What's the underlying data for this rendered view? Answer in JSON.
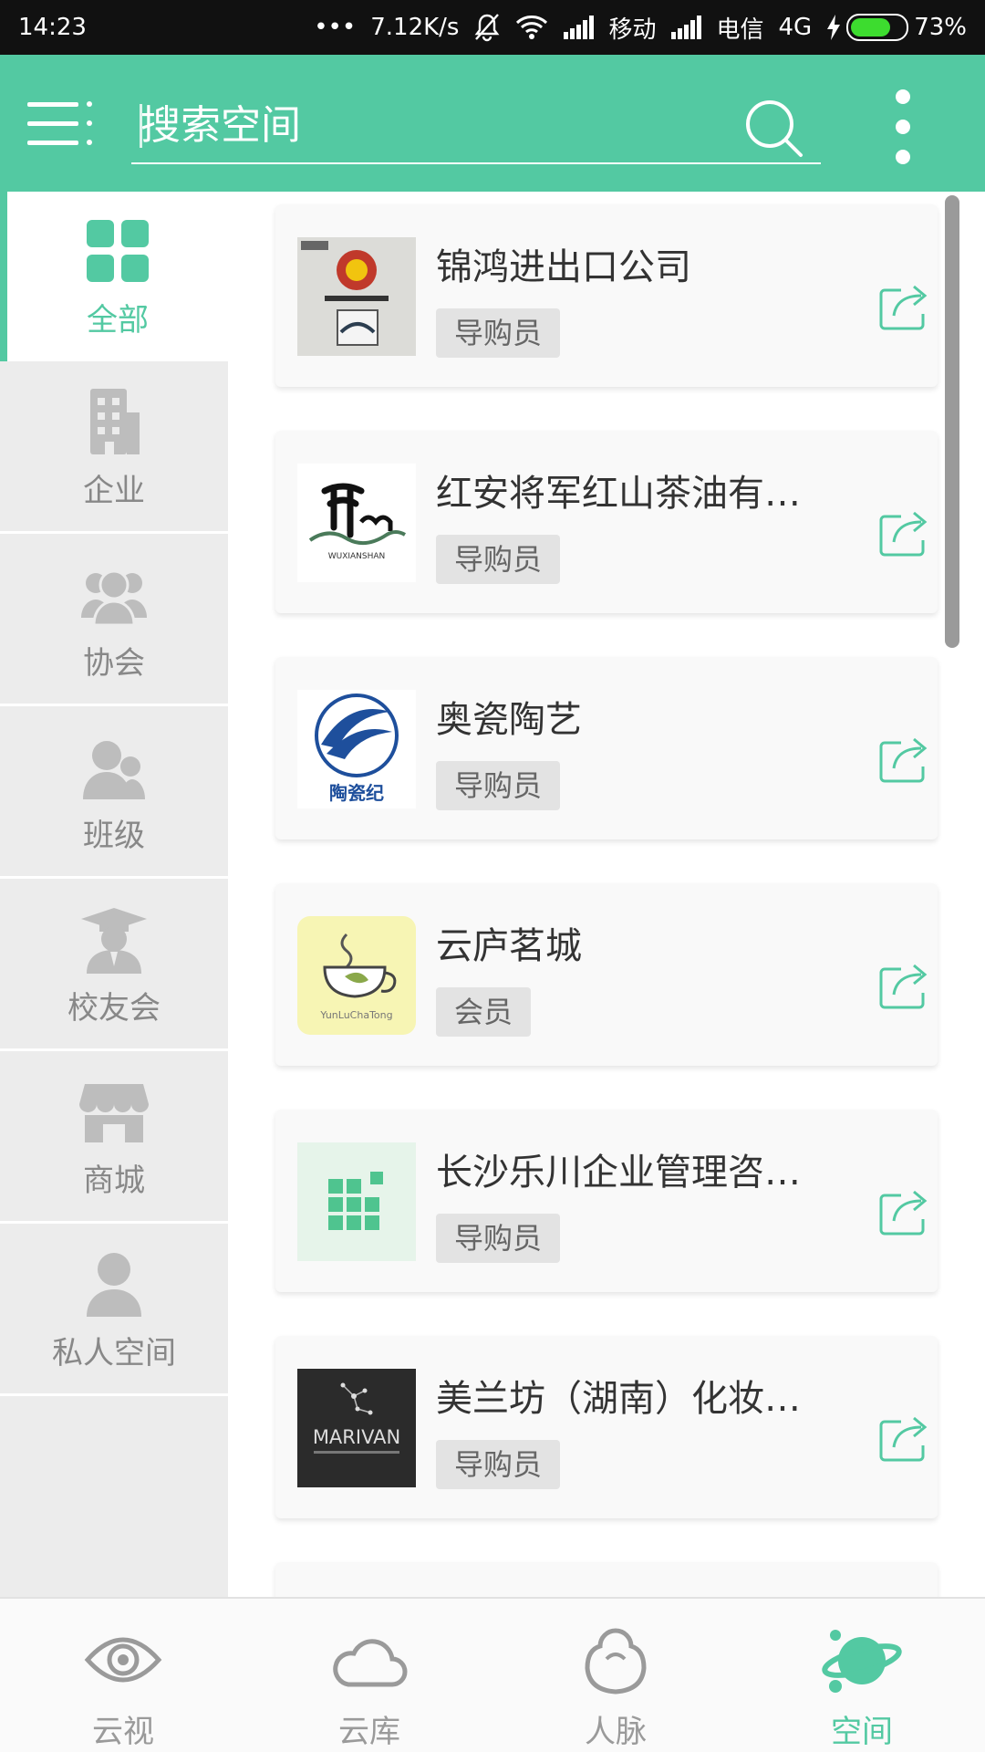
{
  "status_bar": {
    "time": "14:23",
    "dots": "•••",
    "network_speed": "7.12K/s",
    "carrier1": "移动",
    "carrier2": "电信",
    "network_type": "4G",
    "battery": "73%",
    "battery_level": 0.73
  },
  "header": {
    "search_placeholder": "搜索空间",
    "menu_icon": "hamburger-menu-icon",
    "search_icon": "search-icon",
    "more_icon": "more-vertical-icon",
    "accent": "#53c9a2"
  },
  "sidebar": {
    "items": [
      {
        "label": "全部",
        "icon": "grid-icon",
        "active": true
      },
      {
        "label": "企业",
        "icon": "building-icon"
      },
      {
        "label": "协会",
        "icon": "group-icon"
      },
      {
        "label": "班级",
        "icon": "class-people-icon"
      },
      {
        "label": "校友会",
        "icon": "graduate-icon"
      },
      {
        "label": "商城",
        "icon": "shop-icon"
      },
      {
        "label": "私人空间",
        "icon": "person-icon"
      }
    ]
  },
  "list": {
    "items": [
      {
        "name": "锦鸿进出口公司",
        "role": "导购员"
      },
      {
        "name": "红安将军红山茶油有…",
        "role": "导购员"
      },
      {
        "name": "奥瓷陶艺",
        "role": "导购员"
      },
      {
        "name": "云庐茗城",
        "role": "会员"
      },
      {
        "name": "长沙乐川企业管理咨…",
        "role": "导购员"
      },
      {
        "name": "美兰坊（湖南）化妆…",
        "role": "导购员"
      }
    ],
    "logo_texts": {
      "wuxianshan": "WUXIANSHAN",
      "taociji": "陶瓷纪",
      "yunlu": "YunLuChaTong",
      "marivan": "MARIVAN"
    }
  },
  "bottom_nav": {
    "items": [
      {
        "label": "云视",
        "icon": "eye-icon"
      },
      {
        "label": "云库",
        "icon": "cloud-icon"
      },
      {
        "label": "人脉",
        "icon": "contacts-icon"
      },
      {
        "label": "空间",
        "icon": "planet-icon",
        "active": true
      }
    ]
  }
}
